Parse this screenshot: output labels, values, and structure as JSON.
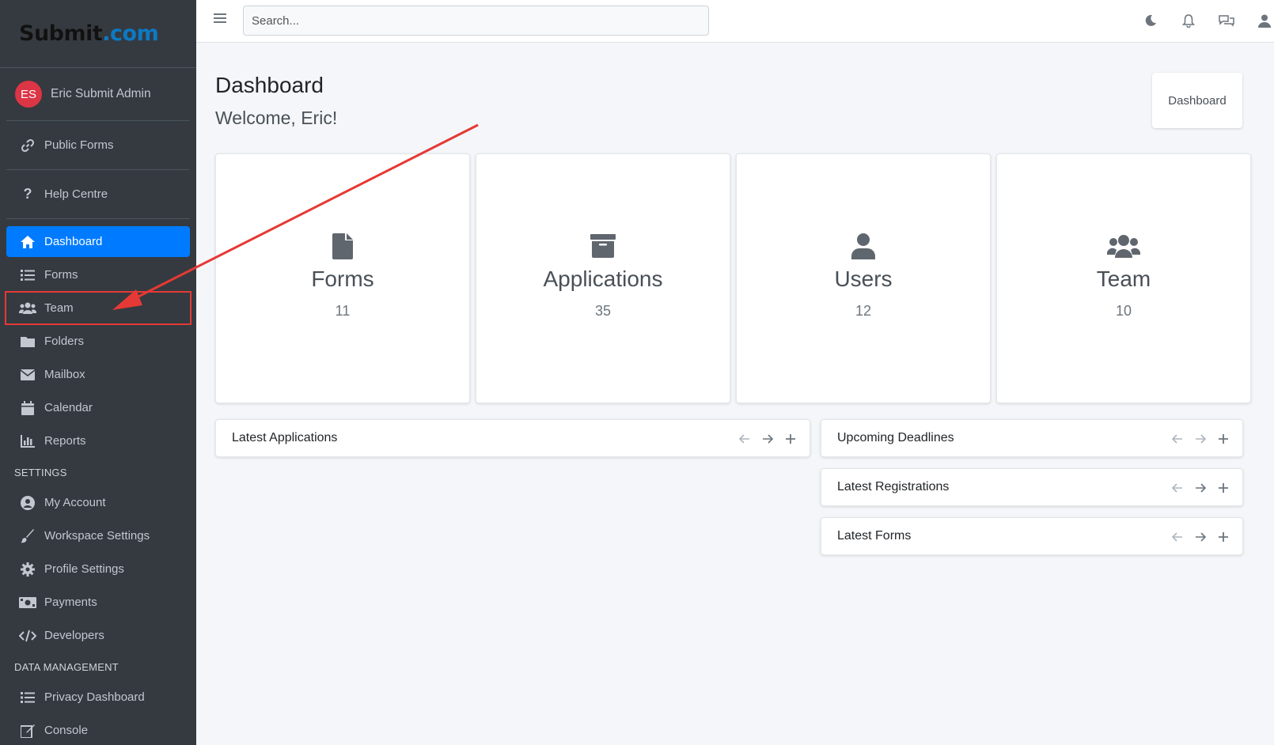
{
  "brand": {
    "part1": "Submit",
    "part2": ".com"
  },
  "user": {
    "initials": "ES",
    "name": "Eric Submit Admin"
  },
  "sidebar": {
    "top_links": [
      {
        "label": "Public Forms",
        "icon": "link-icon"
      },
      {
        "label": "Help Centre",
        "icon": "question-icon"
      }
    ],
    "items": [
      {
        "label": "Dashboard",
        "icon": "home-icon",
        "active": true
      },
      {
        "label": "Forms",
        "icon": "list-icon"
      },
      {
        "label": "Team",
        "icon": "users-icon",
        "highlighted": true
      },
      {
        "label": "Folders",
        "icon": "folder-icon"
      },
      {
        "label": "Mailbox",
        "icon": "envelope-icon"
      },
      {
        "label": "Calendar",
        "icon": "calendar-icon"
      },
      {
        "label": "Reports",
        "icon": "chart-icon"
      }
    ],
    "settings_header": "SETTINGS",
    "settings": [
      {
        "label": "My Account",
        "icon": "user-circle-icon"
      },
      {
        "label": "Workspace Settings",
        "icon": "brush-icon"
      },
      {
        "label": "Profile Settings",
        "icon": "gear-icon"
      },
      {
        "label": "Payments",
        "icon": "money-icon"
      },
      {
        "label": "Developers",
        "icon": "code-icon"
      }
    ],
    "data_header": "DATA MANAGEMENT",
    "data": [
      {
        "label": "Privacy Dashboard",
        "icon": "list-icon"
      },
      {
        "label": "Console",
        "icon": "edit-icon"
      }
    ]
  },
  "topbar": {
    "search_placeholder": "Search..."
  },
  "page": {
    "title": "Dashboard",
    "welcome": "Welcome, Eric!",
    "breadcrumb": "Dashboard"
  },
  "stats": [
    {
      "label": "Forms",
      "value": "11",
      "icon": "file-icon"
    },
    {
      "label": "Applications",
      "value": "35",
      "icon": "archive-icon"
    },
    {
      "label": "Users",
      "value": "12",
      "icon": "user-icon"
    },
    {
      "label": "Team",
      "value": "10",
      "icon": "users-icon"
    }
  ],
  "panels": {
    "latest_applications": "Latest Applications",
    "upcoming_deadlines": "Upcoming Deadlines",
    "latest_registrations": "Latest Registrations",
    "latest_forms": "Latest Forms"
  },
  "colors": {
    "sidebar_bg": "#343a40",
    "active": "#007bff",
    "annotation": "#e53935",
    "avatar": "#dc3545"
  }
}
